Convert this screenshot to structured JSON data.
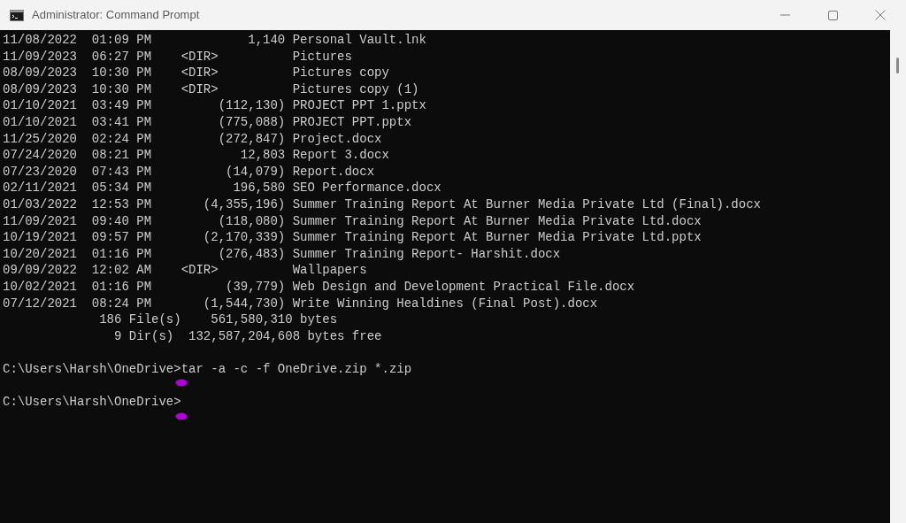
{
  "window": {
    "title": "Administrator: Command Prompt"
  },
  "console": {
    "lines": [
      "11/08/2022  01:09 PM             1,140 Personal Vault.lnk",
      "11/09/2023  06:27 PM    <DIR>          Pictures",
      "08/09/2023  10:30 PM    <DIR>          Pictures copy",
      "08/09/2023  10:30 PM    <DIR>          Pictures copy (1)",
      "01/10/2021  03:49 PM         (112,130) PROJECT PPT 1.pptx",
      "01/10/2021  03:41 PM         (775,088) PROJECT PPT.pptx",
      "11/25/2020  02:24 PM         (272,847) Project.docx",
      "07/24/2020  08:21 PM            12,803 Report 3.docx",
      "07/23/2020  07:43 PM          (14,079) Report.docx",
      "02/11/2021  05:34 PM           196,580 SEO Performance.docx",
      "01/03/2022  12:53 PM       (4,355,196) Summer Training Report At Burner Media Private Ltd (Final).docx",
      "11/09/2021  09:40 PM         (118,080) Summer Training Report At Burner Media Private Ltd.docx",
      "10/19/2021  09:57 PM       (2,170,339) Summer Training Report At Burner Media Private Ltd.pptx",
      "10/20/2021  01:16 PM         (276,483) Summer Training Report- Harshit.docx",
      "09/09/2022  12:02 AM    <DIR>          Wallpapers",
      "10/02/2021  01:16 PM          (39,779) Web Design and Development Practical File.docx",
      "07/12/2021  08:24 PM       (1,544,730) Write Winning Healdines (Final Post).docx",
      "             186 File(s)    561,580,310 bytes",
      "               9 Dir(s)  132,587,204,608 bytes free"
    ],
    "commands": [
      {
        "prompt": "C:\\Users\\Harsh\\OneDrive>",
        "input": "tar -a -c -f OneDrive.zip *.zip"
      },
      {
        "prompt": "C:\\Users\\Harsh\\OneDrive>"
      }
    ]
  }
}
